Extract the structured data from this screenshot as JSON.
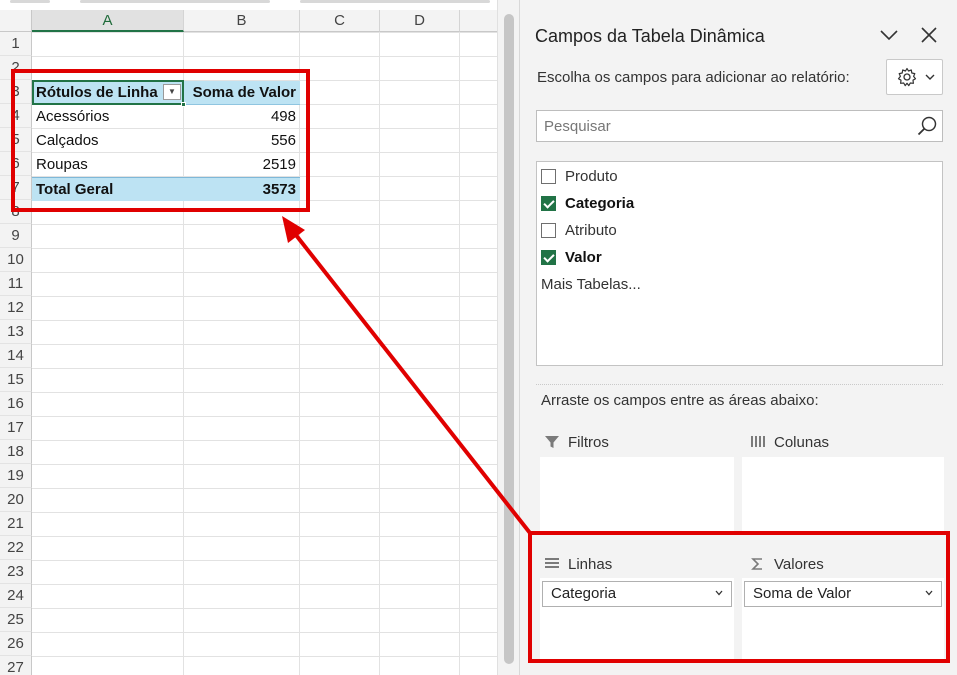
{
  "sheet": {
    "columns": [
      "A",
      "B",
      "C",
      "D"
    ],
    "rows": [
      "1",
      "2",
      "3",
      "4",
      "5",
      "6",
      "7",
      "8",
      "9",
      "10",
      "11",
      "12",
      "13",
      "14",
      "15",
      "16",
      "17",
      "18",
      "19",
      "20",
      "21",
      "22",
      "23",
      "24",
      "25",
      "26",
      "27"
    ]
  },
  "pivot": {
    "header_rows": "Rótulos de Linha",
    "header_values": "Soma de Valor",
    "filter_glyph": "▼",
    "rows": [
      {
        "label": "Acessórios",
        "value": "498"
      },
      {
        "label": "Calçados",
        "value": "556"
      },
      {
        "label": "Roupas",
        "value": "2519"
      }
    ],
    "total": {
      "label": "Total Geral",
      "value": "3573"
    }
  },
  "pane": {
    "title": "Campos da Tabela Dinâmica",
    "prompt": "Escolha os campos para adicionar ao relatório:",
    "search_placeholder": "Pesquisar",
    "fields": [
      {
        "label": "Produto",
        "checked": false
      },
      {
        "label": "Categoria",
        "checked": true
      },
      {
        "label": "Atributo",
        "checked": false
      },
      {
        "label": "Valor",
        "checked": true
      }
    ],
    "more_tables": "Mais Tabelas...",
    "drag_label": "Arraste os campos entre as áreas abaixo:",
    "areas": {
      "filters": {
        "label": "Filtros",
        "icon": "filter-icon"
      },
      "columns": {
        "label": "Colunas",
        "icon": "columns-icon"
      },
      "rows": {
        "label": "Linhas",
        "icon": "rows-icon",
        "item": "Categoria"
      },
      "values": {
        "label": "Valores",
        "icon": "sigma-icon",
        "item": "Soma de Valor"
      }
    }
  },
  "colors": {
    "accent_green": "#217346",
    "pivot_blue": "#bde3f3",
    "annotation_red": "#e00000"
  }
}
